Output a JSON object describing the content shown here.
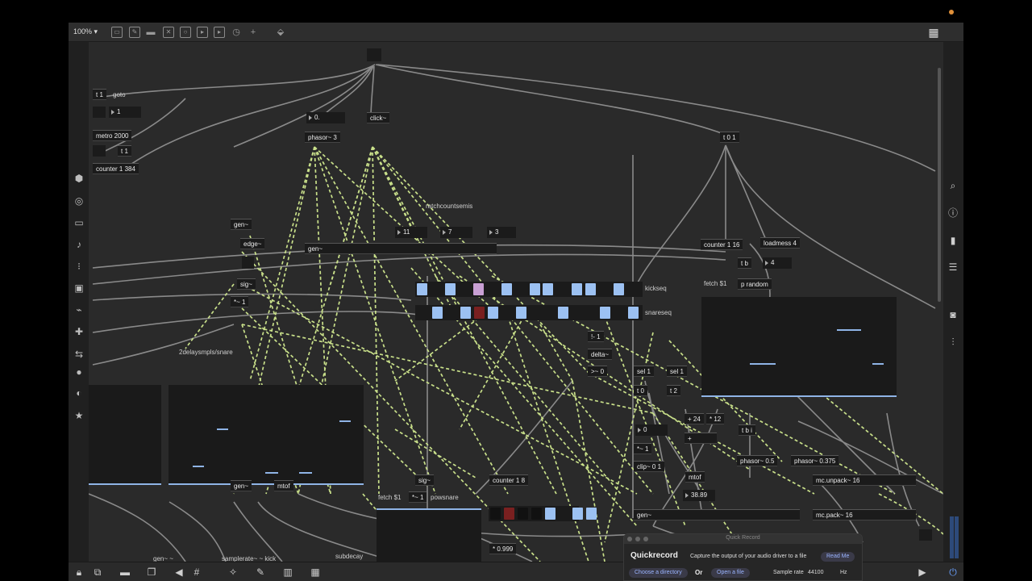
{
  "toolbar": {
    "zoom": "100% ▾",
    "icons": [
      "patcher-icon",
      "message-icon",
      "comment-icon",
      "toggle-icon",
      "bang-icon",
      "slider-icon",
      "number-icon",
      "dial-icon",
      "add-icon",
      "paint-icon"
    ],
    "grid_icon": "grid-icon"
  },
  "left_sidebar": [
    "packages-icon",
    "target-icon",
    "panel-icon",
    "music-note-icon",
    "sequencer-icon",
    "image-icon",
    "link-icon",
    "plugin-icon",
    "controller-icon",
    "record-icon",
    "reverse-icon",
    "star-icon"
  ],
  "right_sidebar": [
    "search-icon",
    "info-icon",
    "book-icon",
    "list-icon",
    "camera-icon",
    "mixer-icon"
  ],
  "bottom_bar": [
    "lock-icon",
    "new-patcher-icon",
    "presentation-icon",
    "windows-icon",
    "mute-icon",
    "grid-snap-icon",
    "wand-icon",
    "wrench-icon",
    "keyboard-icon",
    "mc-icon",
    "play-icon",
    "power-icon"
  ],
  "patch": {
    "objects": {
      "t11": "t 1",
      "goto": "goto",
      "num_1": "1",
      "metro": "metro 2000",
      "t11b": "t 1",
      "counter384": "counter 1 384",
      "num_0dot": "0.",
      "phasor3": "phasor~ 3",
      "click": "click~",
      "t01": "t 0 1",
      "gen1": "gen~",
      "edge": "edge~",
      "sig1": "sig~",
      "minus1": "*~ 1",
      "gen_main": "gen~",
      "ratch_comment": "ratchcountsemis",
      "num_11": "11",
      "num_7": "7",
      "num_3": "3",
      "counter16": "counter 1 16",
      "loadmess": "loadmess 4",
      "tb": "t b",
      "num_4": "4",
      "fetch1": "fetch $1",
      "prandom": "p random",
      "kickseq": "kickseq",
      "snareseq": "snareseq",
      "delay_comment": "2delaysmpls/snare",
      "t1": "!- 1",
      "delta": "delta~",
      "gt0": ">~ 0",
      "sel1a": "sel 1",
      "sel1b": "sel 1",
      "t0": "t 0",
      "t2": "t 2",
      "plus24": "+ 24",
      "times12": "* 12",
      "tbi": "t b i",
      "num_0": "0",
      "times1": "*~ 1",
      "plus": "+",
      "clip": "clip~ 0 1",
      "phasor05": "phasor~ 0.5",
      "phasor0375": "phasor~ 0.375",
      "mcunpack": "mc.unpack~ 16",
      "mcpack": "mc.pack~ 16",
      "mtof1": "mtof",
      "mtof2": "mtof",
      "num_3889": "38.89",
      "gen2": "gen~",
      "gen3": "gen~",
      "sig2": "sig~",
      "counter8": "counter 1 8",
      "fetch2": "fetch $1",
      "minus2": "*~ 1",
      "powsnare": "powsnare",
      "times0999": "* 0.999",
      "bottom_a": "gen~ ~",
      "bottom_b": "samplerate~ ~ kick",
      "bottom_c": "subdecay"
    },
    "kick_cells": [
      "on",
      "on",
      "pink",
      "on",
      "on",
      "on",
      "on",
      "on",
      "on"
    ],
    "snare_cells": [
      "on",
      "on",
      "red",
      "on",
      "on",
      "on",
      "on",
      "on"
    ],
    "counter8_cells": [
      "dark",
      "red",
      "dark",
      "dark",
      "on",
      "on",
      "on"
    ]
  },
  "quick_record": {
    "window_title": "Quick Record",
    "heading": "Quickrecord",
    "description": "Capture the output of your audio driver to a file",
    "read_me": "Read Me",
    "choose_directory": "Choose a directory",
    "or": "Or",
    "open_file": "Open a file",
    "sample_rate_label": "Sample rate",
    "sample_rate_value": "44100",
    "hz": "Hz"
  },
  "colors": {
    "background": "#2a2a2a",
    "cell_on": "#9cc1f2",
    "cell_pink": "#c9a0d4",
    "cell_red": "#7a2020",
    "signal_cord": "#c9e08a",
    "accent": "#8fb4e6"
  }
}
